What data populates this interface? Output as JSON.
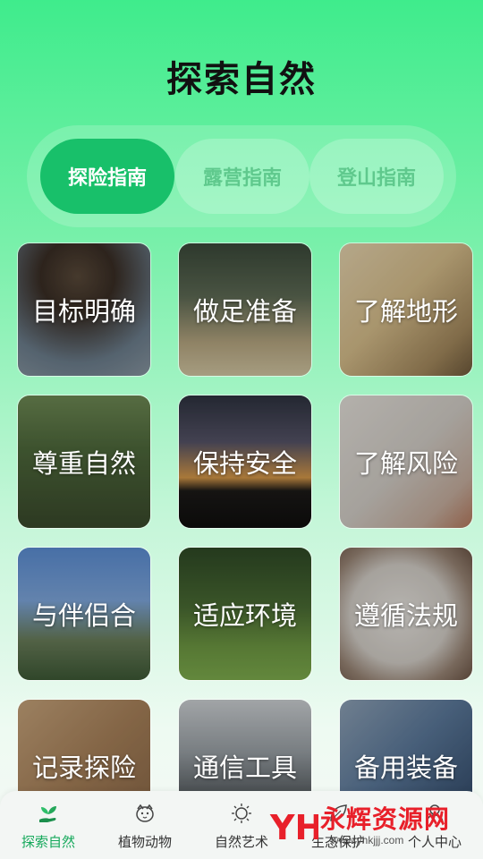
{
  "page": {
    "title": "探索自然"
  },
  "tabs": [
    {
      "label": "探险指南",
      "active": true
    },
    {
      "label": "露营指南",
      "active": false
    },
    {
      "label": "登山指南",
      "active": false
    }
  ],
  "cards": [
    {
      "label": "目标明确"
    },
    {
      "label": "做足准备"
    },
    {
      "label": "了解地形"
    },
    {
      "label": "尊重自然"
    },
    {
      "label": "保持安全"
    },
    {
      "label": "了解风险"
    },
    {
      "label": "与伴侣合"
    },
    {
      "label": "适应环境"
    },
    {
      "label": "遵循法规"
    },
    {
      "label": "记录探险"
    },
    {
      "label": "通信工具"
    },
    {
      "label": "备用装备"
    }
  ],
  "bottom_nav": [
    {
      "label": "探索自然",
      "icon": "sprout-hand-icon",
      "active": true
    },
    {
      "label": "植物动物",
      "icon": "animal-face-icon",
      "active": false
    },
    {
      "label": "自然艺术",
      "icon": "sun-icon",
      "active": false
    },
    {
      "label": "生态保护",
      "icon": "leaf-icon",
      "active": false
    },
    {
      "label": "个人中心",
      "icon": "person-icon",
      "active": false
    }
  ],
  "watermark": {
    "text": "永辉资源网",
    "url": "www.yhkjjj.com",
    "logo": "YH"
  },
  "colors": {
    "accent": "#18c06a",
    "active_nav": "#14a85a",
    "watermark_red": "#e8202a"
  }
}
